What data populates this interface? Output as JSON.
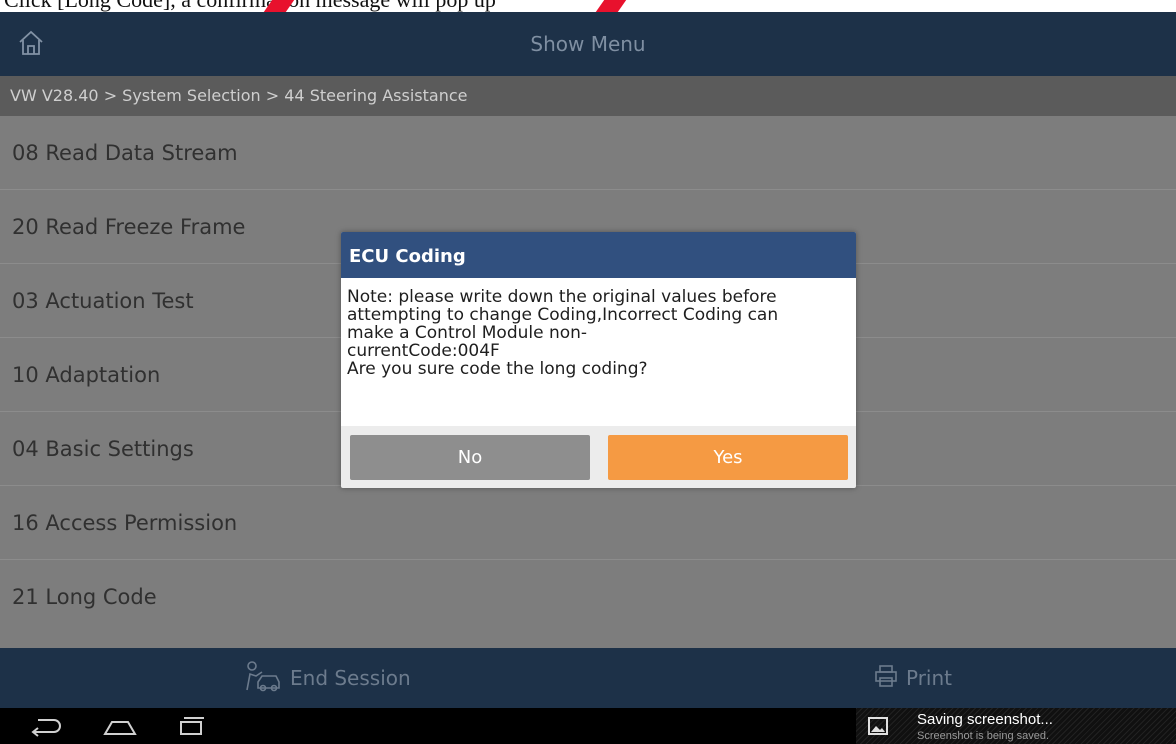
{
  "document": {
    "caption_fragment": "Click [Long Code], a confirmation message will pop up"
  },
  "header": {
    "title": "Show Menu"
  },
  "breadcrumb": "VW V28.40 > System Selection > 44 Steering Assistance",
  "menu": {
    "items": [
      {
        "label": "08 Read Data Stream"
      },
      {
        "label": "20 Read Freeze Frame"
      },
      {
        "label": "03 Actuation Test"
      },
      {
        "label": "10 Adaptation"
      },
      {
        "label": "04 Basic Settings"
      },
      {
        "label": "16 Access Permission"
      },
      {
        "label": "21 Long Code"
      }
    ]
  },
  "dialog": {
    "title": "ECU Coding",
    "lines": [
      "Note: please write down the original values before",
      "attempting to change Coding,Incorrect Coding can",
      "make a Control Module non-",
      "currentCode:004F",
      "Are you sure code the long coding?"
    ],
    "no_label": "No",
    "yes_label": "Yes"
  },
  "footer": {
    "end_session_label": "End Session",
    "print_label": "Print"
  },
  "notification": {
    "title": "Saving screenshot...",
    "subtitle": "Screenshot is being saved."
  },
  "colors": {
    "header_bg": "#1d3148",
    "dialog_title_bg": "#31507f",
    "yes_button": "#f59a43",
    "no_button": "#8e8e8e"
  },
  "icons": {
    "home": "home-icon",
    "end_session": "mechanic-car-icon",
    "print": "printer-icon",
    "back": "back-icon",
    "home_nav": "home-nav-icon",
    "recents": "recents-icon",
    "screenshot": "image-icon"
  }
}
